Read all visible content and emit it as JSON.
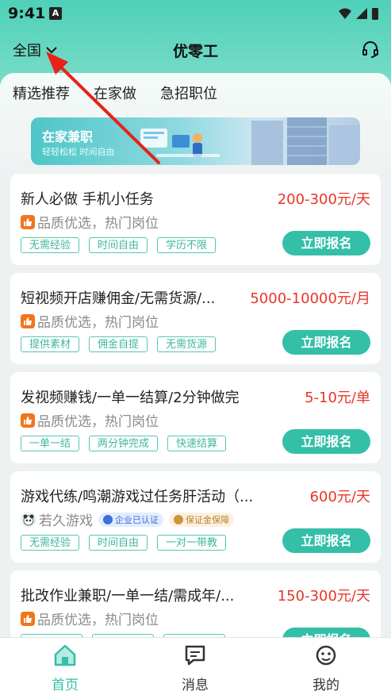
{
  "status_bar": {
    "time": "9:41",
    "notif_letter": "A"
  },
  "header": {
    "region": "全国",
    "title": "优零工"
  },
  "tabs": [
    {
      "label": "精选推荐",
      "active": true
    },
    {
      "label": "在家做",
      "active": false
    },
    {
      "label": "急招职位",
      "active": false
    }
  ],
  "banner": {
    "title": "在家兼职",
    "subtitle": "轻轻松松  时间自由"
  },
  "jobs": [
    {
      "title": "新人必做 手机小任务",
      "salary": "200-300元/天",
      "source": "品质优选，热门岗位",
      "tags": [
        "无需经验",
        "时间自由",
        "学历不限"
      ],
      "apply": "立即报名"
    },
    {
      "title": "短视频开店赚佣金/无需货源/...",
      "salary": "5000-10000元/月",
      "source": "品质优选，热门岗位",
      "tags": [
        "提供素材",
        "佣金自提",
        "无需货源"
      ],
      "apply": "立即报名"
    },
    {
      "title": "发视频赚钱/一单一结算/2分钟做完",
      "salary": "5-10元/单",
      "source": "品质优选，热门岗位",
      "tags": [
        "一单一结",
        "两分钟完成",
        "快速结算"
      ],
      "apply": "立即报名"
    },
    {
      "title": "游戏代练/鸣潮游戏过任务肝活动（...",
      "salary": "600元/天",
      "source": "若久游戏",
      "cert1": "企业已认证",
      "cert2": "保证金保障",
      "tags": [
        "无需经验",
        "时间自由",
        "一对一带教"
      ],
      "apply": "立即报名"
    },
    {
      "title": "批改作业兼职/一单一结/需成年/...",
      "salary": "150-300元/天",
      "source": "品质优选，热门岗位",
      "tags": [
        "",
        "",
        ""
      ],
      "apply": "立即报名"
    }
  ],
  "bottom_nav": [
    {
      "label": "首页",
      "icon": "home-icon",
      "active": true
    },
    {
      "label": "消息",
      "icon": "message-icon",
      "active": false
    },
    {
      "label": "我的",
      "icon": "profile-icon",
      "active": false
    }
  ],
  "colors": {
    "accent": "#33bfa8",
    "salary": "#e8352a",
    "arrow": "#e8211a"
  }
}
